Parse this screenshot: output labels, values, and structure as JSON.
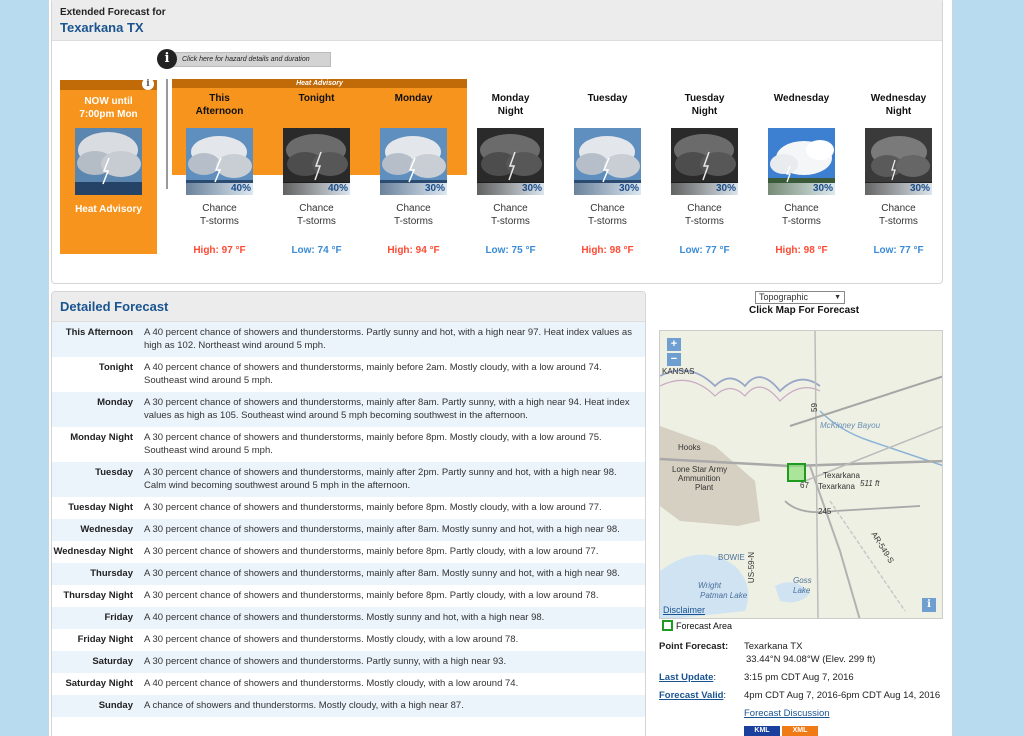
{
  "header": {
    "subtitle": "Extended Forecast for",
    "location": "Texarkana TX"
  },
  "hazard_button": {
    "label": "Click here for hazard details and duration"
  },
  "now_card": {
    "label_line1": "NOW until",
    "label_line2": "7:00pm Mon",
    "hazard": "Heat Advisory"
  },
  "hazard_band_label": "Heat Advisory",
  "periods": [
    {
      "name1": "This",
      "name2": "Afternoon",
      "pop": "40%",
      "desc1": "Chance",
      "desc2": "T-storms",
      "temp": "High: 97 °F"
    },
    {
      "name1": "Tonight",
      "name2": "",
      "pop": "40%",
      "desc1": "Chance",
      "desc2": "T-storms",
      "temp": "Low: 74 °F"
    },
    {
      "name1": "Monday",
      "name2": "",
      "pop": "30%",
      "desc1": "Chance",
      "desc2": "T-storms",
      "temp": "High: 94 °F"
    },
    {
      "name1": "Monday",
      "name2": "Night",
      "pop": "30%",
      "desc1": "Chance",
      "desc2": "T-storms",
      "temp": "Low: 75 °F"
    },
    {
      "name1": "Tuesday",
      "name2": "",
      "pop": "30%",
      "desc1": "Chance",
      "desc2": "T-storms",
      "temp": "High: 98 °F"
    },
    {
      "name1": "Tuesday",
      "name2": "Night",
      "pop": "30%",
      "desc1": "Chance",
      "desc2": "T-storms",
      "temp": "Low: 77 °F"
    },
    {
      "name1": "Wednesday",
      "name2": "",
      "pop": "30%",
      "desc1": "Chance",
      "desc2": "T-storms",
      "temp": "High: 98 °F"
    },
    {
      "name1": "Wednesday",
      "name2": "Night",
      "pop": "30%",
      "desc1": "Chance",
      "desc2": "T-storms",
      "temp": "Low: 77 °F"
    }
  ],
  "detailed": {
    "title": "Detailed Forecast",
    "rows": [
      {
        "label": "This Afternoon",
        "text": "A 40 percent chance of showers and thunderstorms. Partly sunny and hot, with a high near 97. Heat index values as high as 102. Northeast wind around 5 mph."
      },
      {
        "label": "Tonight",
        "text": "A 40 percent chance of showers and thunderstorms, mainly before 2am. Mostly cloudy, with a low around 74. Southeast wind around 5 mph."
      },
      {
        "label": "Monday",
        "text": "A 30 percent chance of showers and thunderstorms, mainly after 8am. Partly sunny, with a high near 94. Heat index values as high as 105. Southeast wind around 5 mph becoming southwest in the afternoon."
      },
      {
        "label": "Monday Night",
        "text": "A 30 percent chance of showers and thunderstorms, mainly before 8pm. Mostly cloudy, with a low around 75. Southeast wind around 5 mph."
      },
      {
        "label": "Tuesday",
        "text": "A 30 percent chance of showers and thunderstorms, mainly after 2pm. Partly sunny and hot, with a high near 98. Calm wind becoming southwest around 5 mph in the afternoon."
      },
      {
        "label": "Tuesday Night",
        "text": "A 30 percent chance of showers and thunderstorms, mainly before 8pm. Mostly cloudy, with a low around 77."
      },
      {
        "label": "Wednesday",
        "text": "A 30 percent chance of showers and thunderstorms, mainly after 8am. Mostly sunny and hot, with a high near 98."
      },
      {
        "label": "Wednesday Night",
        "text": "A 30 percent chance of showers and thunderstorms, mainly before 8pm. Partly cloudy, with a low around 77."
      },
      {
        "label": "Thursday",
        "text": "A 30 percent chance of showers and thunderstorms, mainly after 8am. Mostly sunny and hot, with a high near 98."
      },
      {
        "label": "Thursday Night",
        "text": "A 30 percent chance of showers and thunderstorms, mainly before 8pm. Partly cloudy, with a low around 78."
      },
      {
        "label": "Friday",
        "text": "A 40 percent chance of showers and thunderstorms. Mostly sunny and hot, with a high near 98."
      },
      {
        "label": "Friday Night",
        "text": "A 30 percent chance of showers and thunderstorms. Mostly cloudy, with a low around 78."
      },
      {
        "label": "Saturday",
        "text": "A 30 percent chance of showers and thunderstorms. Partly sunny, with a high near 93."
      },
      {
        "label": "Saturday Night",
        "text": "A 40 percent chance of showers and thunderstorms. Mostly cloudy, with a low around 74."
      },
      {
        "label": "Sunday",
        "text": "A chance of showers and thunderstorms. Mostly cloudy, with a high near 87."
      }
    ]
  },
  "map": {
    "select_value": "Topographic",
    "click_label": "Click Map For Forecast",
    "zoom_in": "+",
    "zoom_out": "−",
    "disclaimer": "Disclaimer",
    "legend": "Forecast Area",
    "labels": {
      "kansas": "KANSAS",
      "hooks": "Hooks",
      "lonestar1": "Lone Star Army",
      "lonestar2": "Ammunition",
      "lonestar3": "Plant",
      "texarkana1": "Texarkana",
      "texarkana2": "Texarkana",
      "mckinney": "McKinney Bayou",
      "bowie": "BOWIE",
      "wright1": "Wright",
      "wright2": "Patman Lake",
      "goss1": "Goss",
      "goss2": "Lake",
      "us59": "US-59-N",
      "ar549": "AR-549-S",
      "r59": "59",
      "r67": "67",
      "r245": "245",
      "r511": "511 ft"
    }
  },
  "point_forecast": {
    "label": "Point Forecast:",
    "place": "Texarkana TX",
    "coords": "33.44°N 94.08°W (Elev. 299 ft)",
    "last_update_label": "Last Update",
    "last_update_value": "3:15 pm CDT Aug 7, 2016",
    "valid_label": "Forecast Valid",
    "valid_value": "4pm CDT Aug 7, 2016-6pm CDT Aug 14, 2016",
    "discussion": "Forecast Discussion",
    "kml": "KML",
    "xml": "XML"
  },
  "colors": {
    "hazard_orange": "#f7941d",
    "hazard_dark": "#c06a08",
    "high_temp": "#ff4a33",
    "low_temp": "#3a8bd4",
    "link": "#1a5490"
  }
}
